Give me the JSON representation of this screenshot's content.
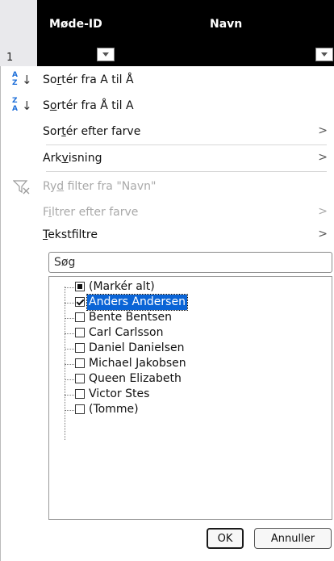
{
  "sheet": {
    "row_number": "1",
    "columns": [
      "Møde-ID",
      "Navn"
    ]
  },
  "menu": {
    "sort_az": {
      "pre": "So",
      "u": "r",
      "post": "tér fra A til Å"
    },
    "sort_za": {
      "pre": "S",
      "u": "o",
      "post": "rtér fra Å til A"
    },
    "sort_color": {
      "pre": "Sor",
      "u": "t",
      "post": "ér efter farve"
    },
    "sheet_view": {
      "pre": "Ark",
      "u": "v",
      "post": "isning"
    },
    "clear_filter": {
      "pre": "Ry",
      "u": "d",
      "post": " filter fra \"Navn\""
    },
    "filter_color": {
      "pre": "F",
      "u": "i",
      "post": "ltrer efter farve"
    },
    "text_filters": {
      "pre": "",
      "u": "T",
      "post": "ekstfiltre"
    },
    "sort_icon_letters_az": [
      "A",
      "Z"
    ],
    "sort_icon_letters_za": [
      "Z",
      "A"
    ]
  },
  "search": {
    "placeholder": "Søg"
  },
  "items": [
    {
      "label": "(Markér alt)",
      "state": "partial"
    },
    {
      "label": "Anders Andersen",
      "state": "checked"
    },
    {
      "label": "Bente Bentsen",
      "state": "unchecked"
    },
    {
      "label": "Carl Carlsson",
      "state": "unchecked"
    },
    {
      "label": "Daniel Danielsen",
      "state": "unchecked"
    },
    {
      "label": "Michael Jakobsen",
      "state": "unchecked"
    },
    {
      "label": "Queen Elizabeth",
      "state": "unchecked"
    },
    {
      "label": "Victor Stes",
      "state": "unchecked"
    },
    {
      "label": "(Tomme)",
      "state": "unchecked"
    }
  ],
  "buttons": {
    "ok": "OK",
    "cancel": "Annuller"
  },
  "colors": {
    "selection": "#0a64d6",
    "icon_blue": "#1e6fd9"
  }
}
